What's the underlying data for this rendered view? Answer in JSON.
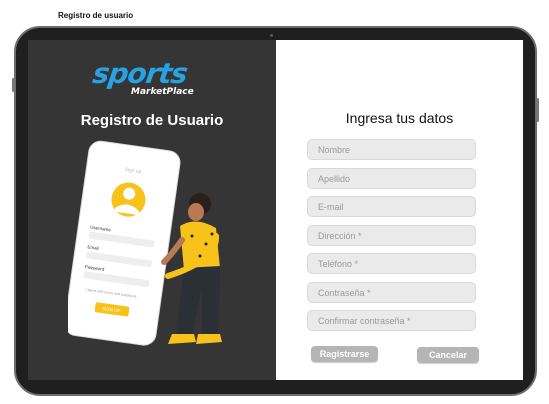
{
  "frame_label": "Registro de usuario",
  "brand": {
    "logo_main": "sports",
    "logo_sub": "MarketPlace"
  },
  "left": {
    "title": "Registro de Usuario",
    "phone": {
      "header": "Sign up",
      "username": "Username",
      "email": "Email",
      "password": "Password",
      "remember": "I agree with terms and conditions",
      "button": "SIGN UP"
    }
  },
  "form": {
    "title": "Ingresa tus datos",
    "fields": [
      {
        "placeholder": "Nombre"
      },
      {
        "placeholder": "Apellido"
      },
      {
        "placeholder": "E-mail"
      },
      {
        "placeholder": "Dirección *"
      },
      {
        "placeholder": "Teléfono *"
      },
      {
        "placeholder": "Contraseña *"
      },
      {
        "placeholder": "Confirmar contraseña *"
      }
    ],
    "register_label": "Ragistrarse",
    "cancel_label": "Cancelar"
  },
  "colors": {
    "panel_dark": "#353535",
    "brand_blue": "#27a3e3",
    "accent_yellow": "#f7c21a",
    "button_gray": "#b5b5b5"
  }
}
